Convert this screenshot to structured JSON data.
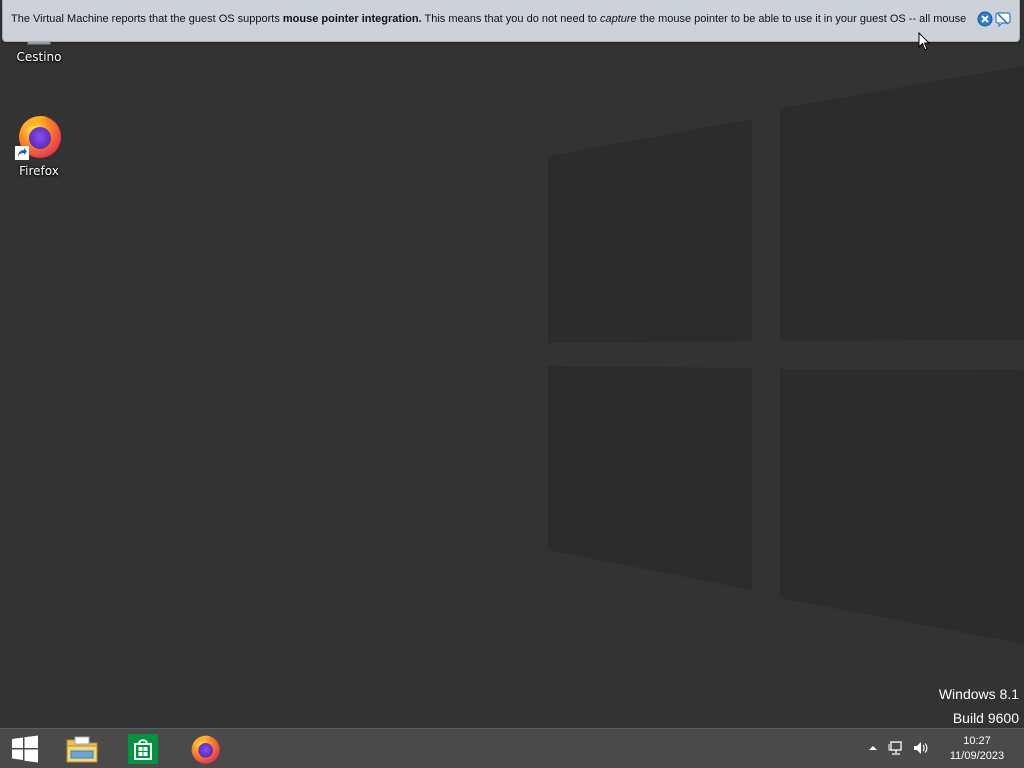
{
  "notification": {
    "text_part1": "The Virtual Machine reports that the guest OS supports ",
    "text_bold": "mouse pointer integration.",
    "text_part2": " This means that you do not need to ",
    "text_italic": "capture",
    "text_part3": " the mouse pointer to be able to use it in your guest OS -- all mouse",
    "close_icon": "close-icon",
    "dont_show_icon": "dont-show-again-icon"
  },
  "desktop": {
    "icons": [
      {
        "label": "Cestino",
        "icon": "recycle-bin-icon"
      },
      {
        "label": "Firefox",
        "icon": "firefox-icon"
      }
    ],
    "watermark": {
      "line1": "Windows 8.1",
      "line2": "Build 9600"
    }
  },
  "taskbar": {
    "start_icon": "windows-logo-icon",
    "pinned": [
      {
        "name": "File Explorer",
        "icon": "file-explorer-icon"
      },
      {
        "name": "Store",
        "icon": "store-icon"
      },
      {
        "name": "Firefox",
        "icon": "firefox-icon"
      }
    ],
    "tray": {
      "time": "10:27",
      "date": "11/09/2023"
    }
  },
  "colors": {
    "desktop_bg": "#333333",
    "taskbar_bg": "#4a4a4a",
    "notification_bg": "#cdd2d8",
    "accent_blue": "#2b7cd3"
  }
}
